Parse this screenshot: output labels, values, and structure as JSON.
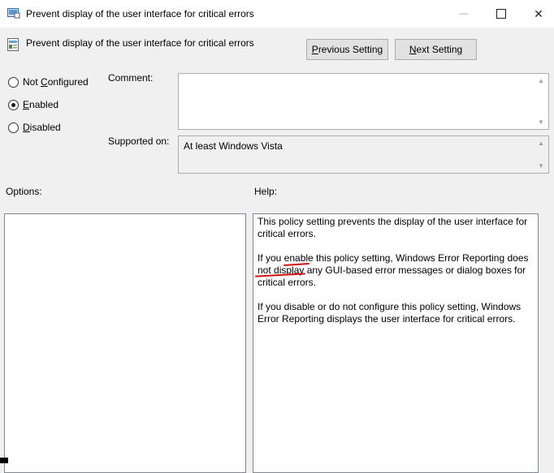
{
  "window": {
    "title": "Prevent display of the user interface for critical errors",
    "minimize_glyph": "—",
    "maximize_glyph": "☐",
    "close_glyph": "✕"
  },
  "header": {
    "policy_name": "Prevent display of the user interface for critical errors",
    "prev_button": {
      "accel": "P",
      "rest": "revious Setting"
    },
    "next_button": {
      "accel": "N",
      "rest": "ext Setting"
    }
  },
  "state_options": [
    {
      "accel": "",
      "pre": "Not ",
      "accel_mid": "C",
      "rest": "onfigured",
      "selected": false
    },
    {
      "accel": "E",
      "pre": "",
      "accel_mid": "",
      "rest": "nabled",
      "selected": true
    },
    {
      "accel": "D",
      "pre": "",
      "accel_mid": "",
      "rest": "isabled",
      "selected": false
    }
  ],
  "comment": {
    "label": "Comment:",
    "value": ""
  },
  "supported_on": {
    "label": "Supported on:",
    "value": "At least Windows Vista"
  },
  "options": {
    "label": "Options:"
  },
  "help": {
    "label": "Help:",
    "paragraphs": [
      "This policy setting prevents the display of the user interface for critical errors.",
      "If you enable this policy setting, Windows Error Reporting does not display any GUI-based error messages or dialog boxes for critical errors.",
      "If you disable or do not configure this policy setting, Windows Error Reporting displays the user interface for critical errors."
    ]
  },
  "colors": {
    "annotation_underline": "#d81010",
    "window_bg": "#f0f0f0"
  },
  "icons": [
    "group-policy-app-icon",
    "policy-setting-icon",
    "scroll-up-icon",
    "scroll-down-icon"
  ]
}
